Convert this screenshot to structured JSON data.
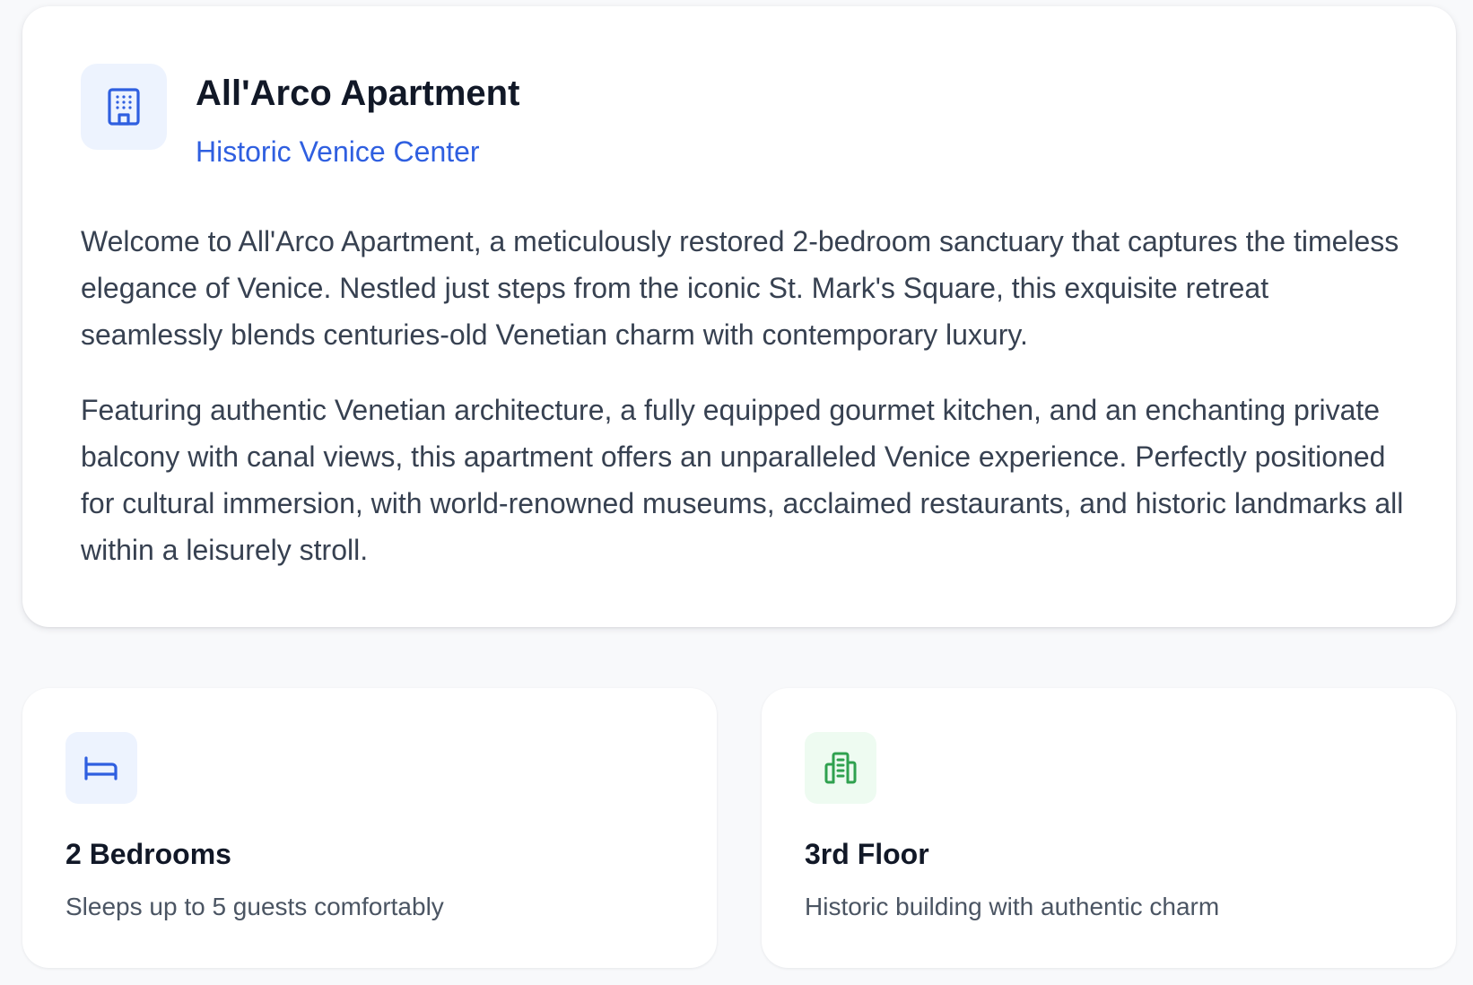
{
  "listing": {
    "title": "All'Arco Apartment",
    "location": "Historic Venice Center",
    "header_icon": "building-icon",
    "description": [
      "Welcome to All'Arco Apartment, a meticulously restored 2-bedroom sanctuary that captures the timeless elegance of Venice. Nestled just steps from the iconic St. Mark's Square, this exquisite retreat seamlessly blends centuries-old Venetian charm with contemporary luxury.",
      "Featuring authentic Venetian architecture, a fully equipped gourmet kitchen, and an enchanting private balcony with canal views, this apartment offers an unparalleled Venice experience. Perfectly positioned for cultural immersion, with world-renowned museums, acclaimed restaurants, and historic landmarks all within a leisurely stroll."
    ]
  },
  "features": [
    {
      "icon": "bed-icon",
      "title": "2 Bedrooms",
      "text": "Sleeps up to 5 guests comfortably",
      "accent": "#2f5fe0"
    },
    {
      "icon": "floor-building-icon",
      "title": "3rd Floor",
      "text": "Historic building with authentic charm",
      "accent": "#2fa14f"
    }
  ],
  "colors": {
    "primary": "#2f5fe0",
    "success": "#2fa14f",
    "heading": "#111827",
    "body_text": "#374151"
  }
}
